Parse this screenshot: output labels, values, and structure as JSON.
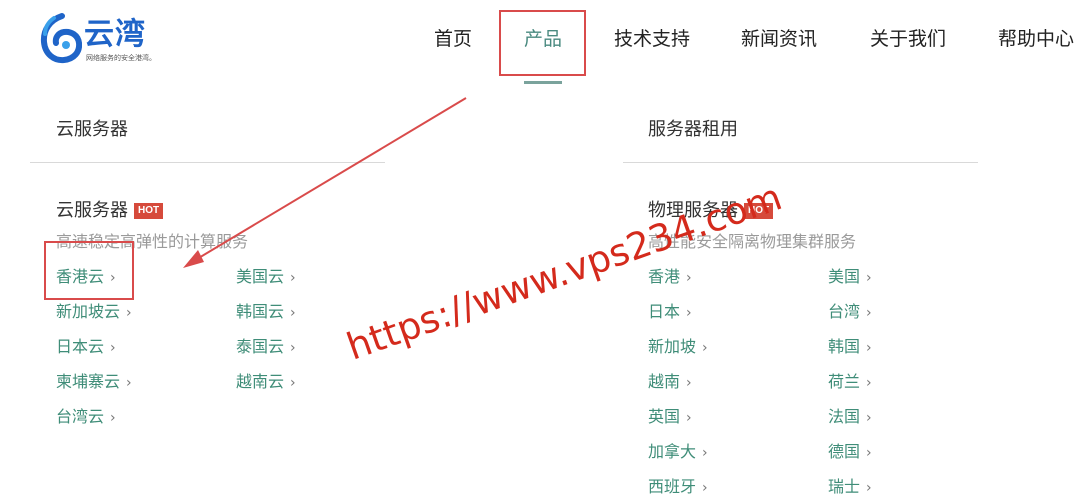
{
  "logo": {
    "name": "云湾",
    "tagline": "网络服务的安全港湾。",
    "brand_color": "#1f64c8"
  },
  "nav": [
    {
      "label": "首页"
    },
    {
      "label": "产品"
    },
    {
      "label": "技术支持"
    },
    {
      "label": "新闻资讯"
    },
    {
      "label": "关于我们"
    },
    {
      "label": "帮助中心"
    }
  ],
  "active_nav": "产品",
  "accent_color": "#3f8d78",
  "highlight_color": "#d94b4b",
  "columns": [
    {
      "title": "云服务器",
      "sub_heading": "云服务器",
      "badge": "HOT",
      "description": "高速稳定高弹性的计算服务",
      "links": [
        "香港云",
        "美国云",
        "新加坡云",
        "韩国云",
        "日本云",
        "泰国云",
        "柬埔寨云",
        "越南云",
        "台湾云"
      ]
    },
    {
      "title": "服务器租用",
      "sub_heading": "物理服务器",
      "badge": "HOT",
      "description": "高性能安全隔离物理集群服务",
      "links": [
        "香港",
        "美国",
        "日本",
        "台湾",
        "新加坡",
        "韩国",
        "越南",
        "荷兰",
        "英国",
        "法国",
        "加拿大",
        "德国",
        "西班牙",
        "瑞士"
      ]
    }
  ],
  "link_chevron": "›",
  "watermark": "https://www.vps234.com"
}
